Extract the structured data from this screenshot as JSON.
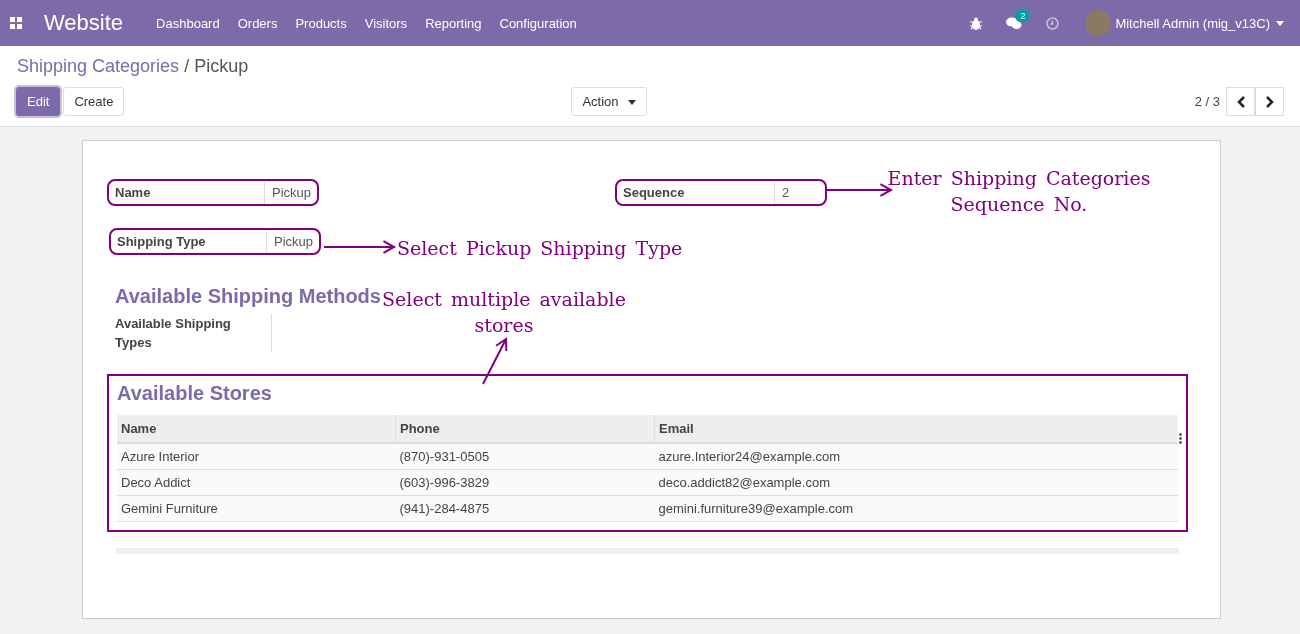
{
  "navbar": {
    "app_name": "Website",
    "menu": [
      "Dashboard",
      "Orders",
      "Products",
      "Visitors",
      "Reporting",
      "Configuration"
    ],
    "messages_badge": "2",
    "user": "Mitchell Admin (mig_v13C)"
  },
  "breadcrumb": {
    "parent": "Shipping Categories",
    "separator": "/",
    "current": "Pickup"
  },
  "buttons": [
    {
      "label": "Edit",
      "kind": "primary"
    },
    {
      "label": "Create",
      "kind": "secondary"
    }
  ],
  "action_menu": "Action",
  "pager": "2 / 3",
  "fields": [
    {
      "label": "Name",
      "value": "Pickup",
      "highlighted": true
    },
    {
      "label": "Sequence",
      "value": "2",
      "highlighted": true
    },
    {
      "label": "Shipping Type",
      "value": "Pickup",
      "highlighted": true
    }
  ],
  "methods_section": {
    "title": "Available Shipping Methods",
    "field_label": "Available Shipping Types"
  },
  "stores_section": {
    "title": "Available Stores",
    "highlighted": true,
    "columns": [
      "Name",
      "Phone",
      "Email"
    ],
    "rows": [
      [
        "Azure Interior",
        "(870)-931-0505",
        "azure.Interior24@example.com"
      ],
      [
        "Deco Addict",
        "(603)-996-3829",
        "deco.addict82@example.com"
      ],
      [
        "Gemini Furniture",
        "(941)-284-4875",
        "gemini.furniture39@example.com"
      ]
    ]
  },
  "annotations": [
    {
      "text": "Enter Shipping Categories Sequence No."
    },
    {
      "text": "Select Pickup Shipping Type"
    },
    {
      "text": "Select multiple available stores"
    }
  ]
}
